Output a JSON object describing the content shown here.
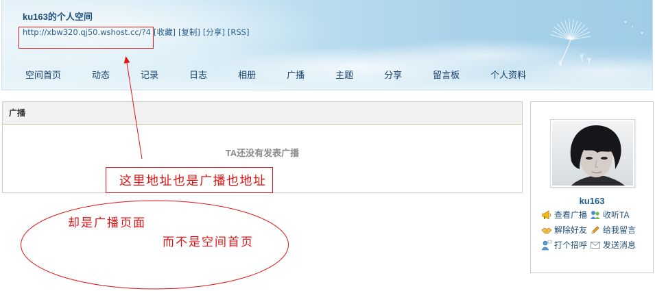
{
  "header": {
    "title": "ku163的个人空间",
    "url": "http://xbw320.qj50.wshost.cc/?4",
    "links": [
      "[收藏]",
      "[复制]",
      "[分享]",
      "[RSS]"
    ]
  },
  "nav": {
    "items": [
      "空间首页",
      "动态",
      "记录",
      "日志",
      "相册",
      "广播",
      "主题",
      "分享",
      "留言板",
      "个人资料"
    ]
  },
  "main": {
    "section_title": "广播",
    "empty_message": "TA还没有发表广播"
  },
  "sidebar": {
    "username": "ku163",
    "actions": [
      {
        "label": "查看广播",
        "icon": "megaphone-icon"
      },
      {
        "label": "收听TA",
        "icon": "listen-people-icon"
      },
      {
        "label": "解除好友",
        "icon": "handshake-icon"
      },
      {
        "label": "给我留言",
        "icon": "pencil-icon"
      },
      {
        "label": "打个招呼",
        "icon": "greet-user-icon"
      },
      {
        "label": "发送消息",
        "icon": "envelope-icon"
      }
    ]
  },
  "annotations": {
    "address_note": "这里地址也是广播也地址",
    "page_note_line1": "却是广播页面",
    "page_note_line2": "而不是空间首页"
  },
  "colors": {
    "title": "#1b4d7e",
    "link": "#255d8d",
    "nav_text": "#17406b",
    "panel_border": "#cacaca",
    "panel_header_bg": "#f2f2f2",
    "panel_header_rule": "#bdd39a",
    "empty_text": "#8a8a8a",
    "username": "#1d5b8d",
    "action_text": "#234f7b",
    "annotation_red": "#e01414"
  }
}
